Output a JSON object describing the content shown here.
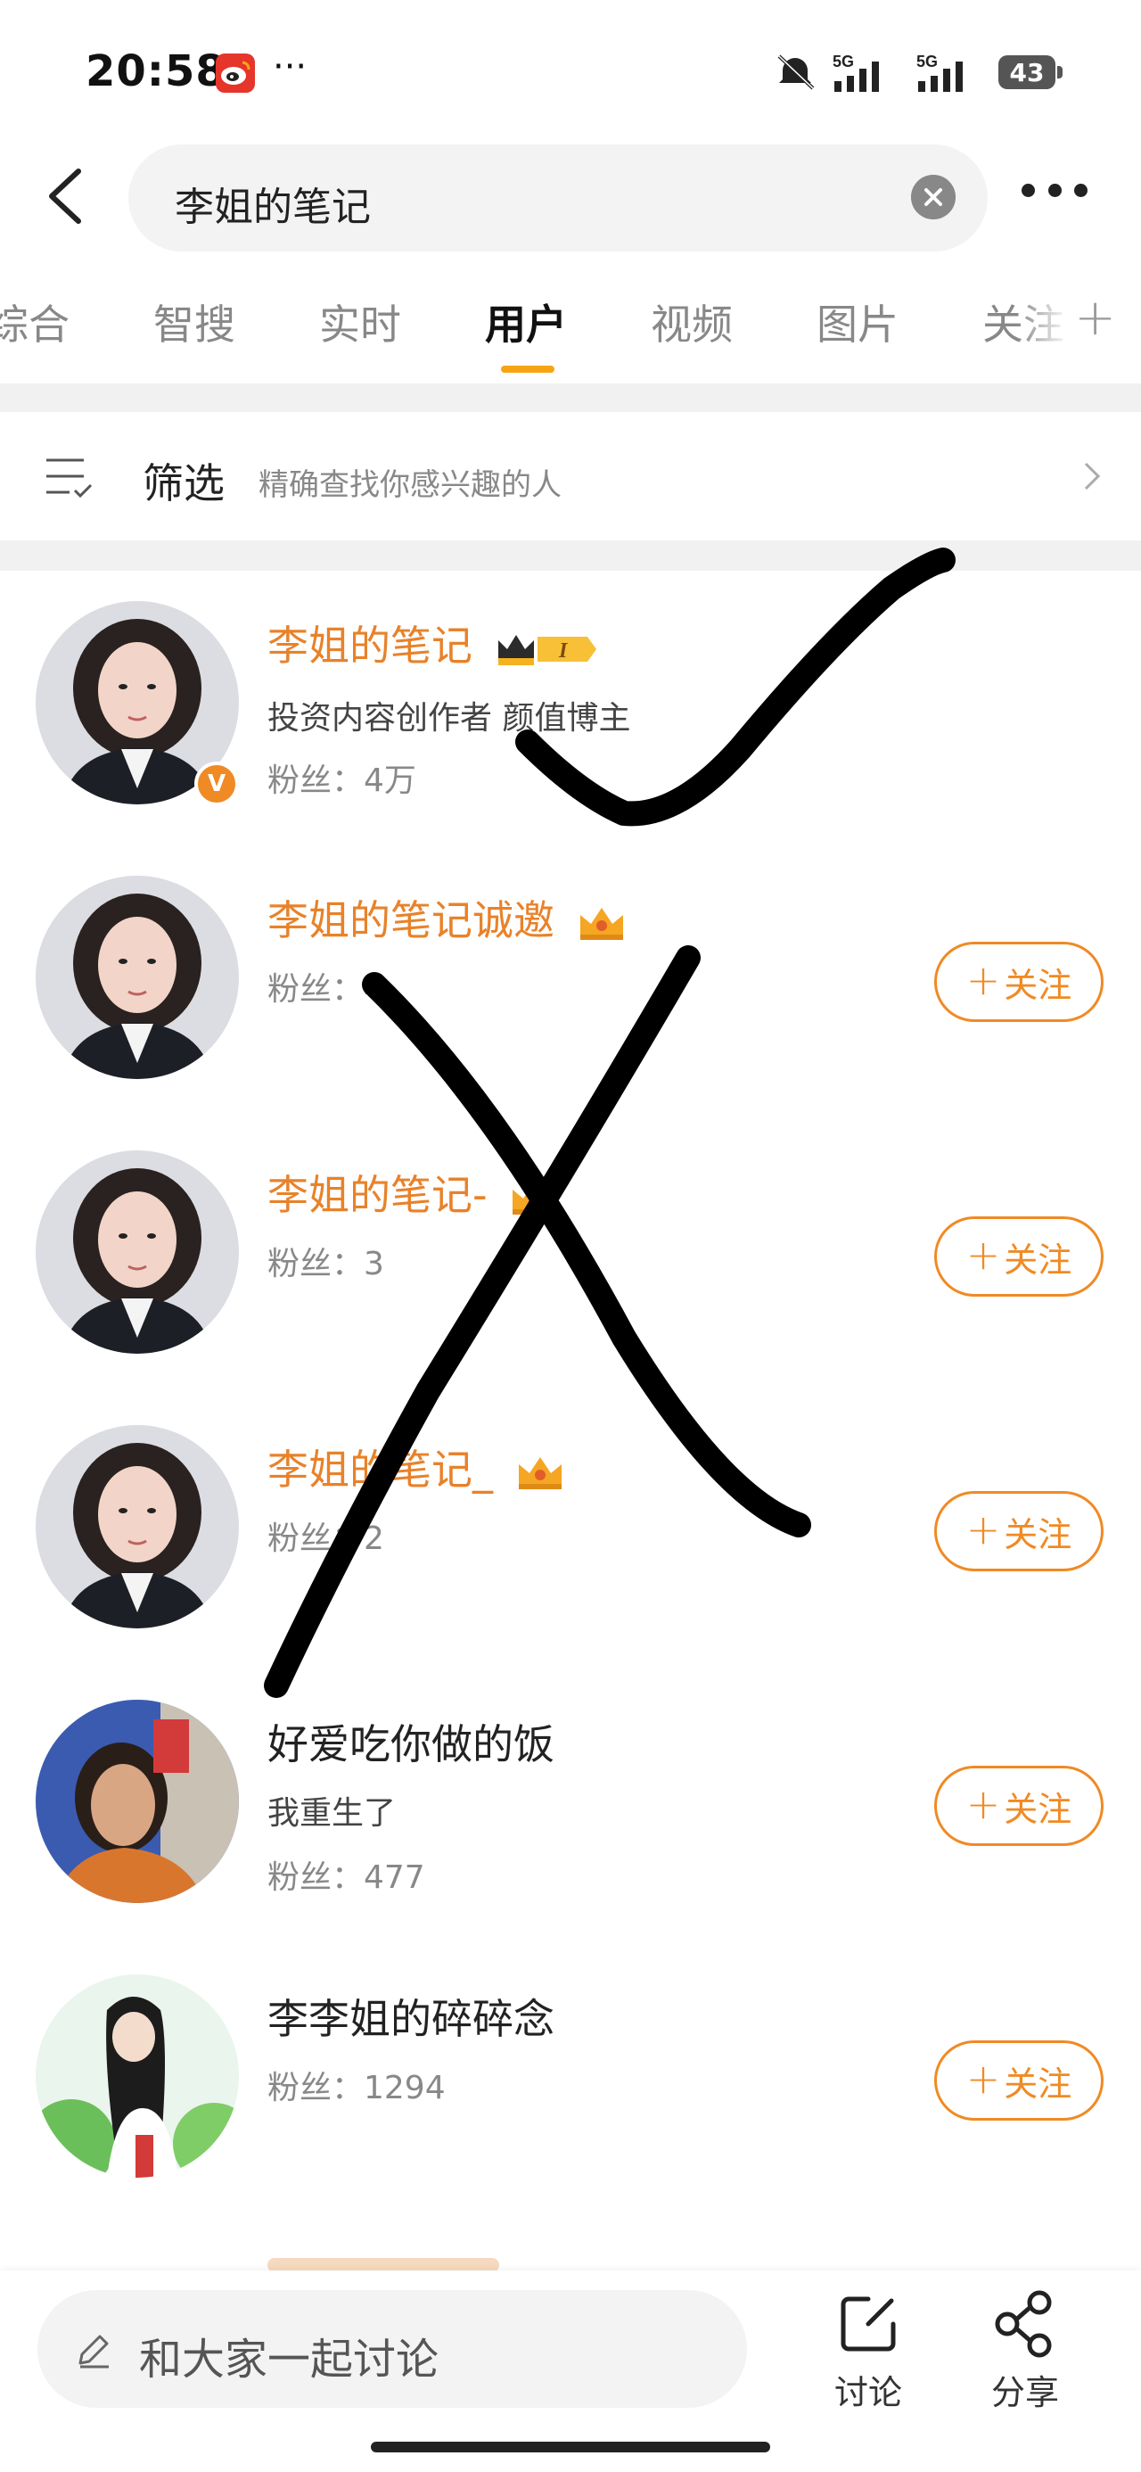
{
  "status_bar": {
    "time": "20:58",
    "more": "···",
    "battery": "43",
    "signal_label_1": "5G",
    "signal_label_2": "5G"
  },
  "search": {
    "query": "李姐的笔记"
  },
  "tabs": [
    {
      "label": "综合"
    },
    {
      "label": "智搜"
    },
    {
      "label": "实时"
    },
    {
      "label": "用户"
    },
    {
      "label": "视频"
    },
    {
      "label": "图片"
    },
    {
      "label": "关注"
    }
  ],
  "tab_add": "+",
  "filter": {
    "label": "筛选",
    "hint": "精确查找你感兴趣的人"
  },
  "users": [
    {
      "name": "李姐的笔记",
      "desc": "投资内容创作者 颜值博主",
      "fans": "粉丝：4万",
      "verified_badge": "V",
      "level": "I",
      "following": true
    },
    {
      "name": "李姐的笔记诚邀",
      "fans": "粉丝：4",
      "follow_label": "关注"
    },
    {
      "name": "李姐的笔记-",
      "fans": "粉丝：3",
      "follow_label": "关注"
    },
    {
      "name": "李姐的笔记_",
      "fans": "粉丝：2",
      "follow_label": "关注"
    },
    {
      "name": "好爱吃你做的饭",
      "desc": "我重生了",
      "fans": "粉丝：477",
      "follow_label": "关注"
    },
    {
      "name": "李李姐的碎碎念",
      "fans": "粉丝：1294",
      "follow_label": "关注"
    }
  ],
  "bottom_bar": {
    "placeholder": "和大家一起讨论",
    "discuss_label": "讨论",
    "share_label": "分享"
  },
  "colors": {
    "accent": "#f08a24",
    "name_orange": "#e8822a",
    "tab_indicator": "#f7a414"
  }
}
